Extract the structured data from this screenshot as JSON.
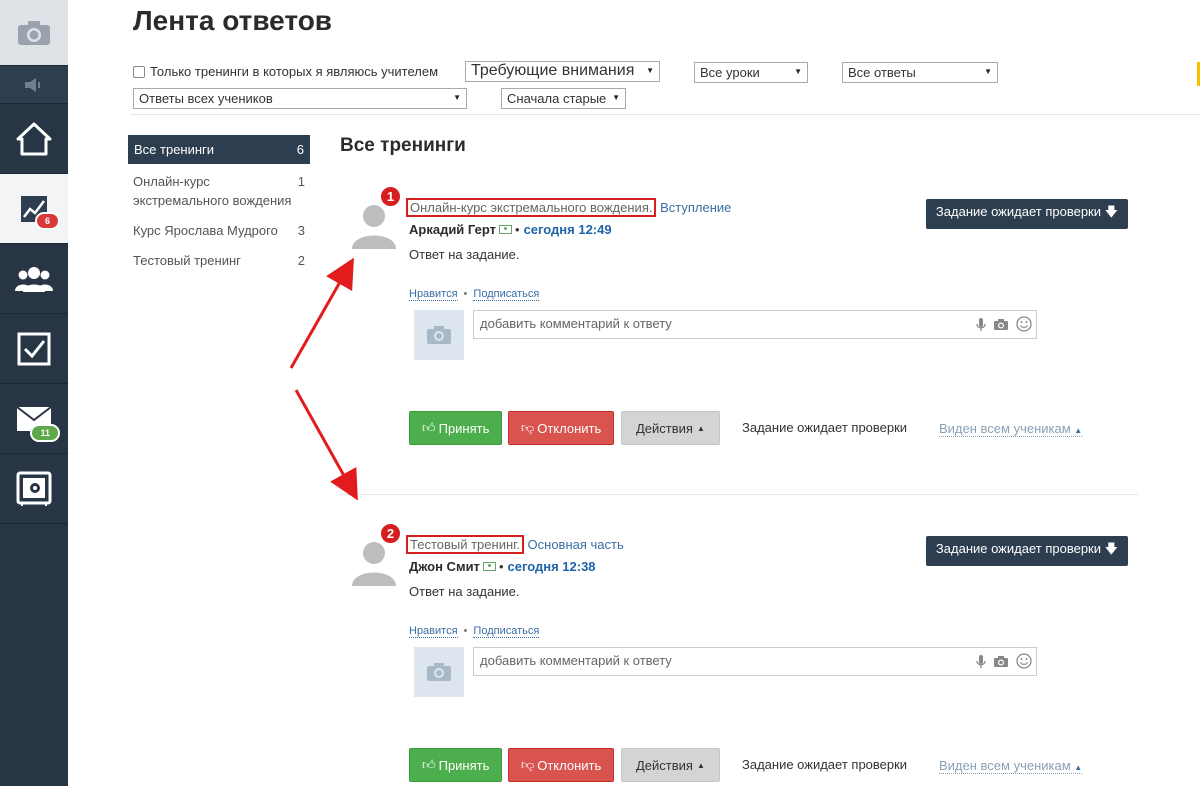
{
  "page": {
    "title": "Лента ответов",
    "section_title": "Все тренинги"
  },
  "nav": {
    "badges": {
      "trainings": "6",
      "messages": "11"
    }
  },
  "filters": {
    "only_teacher_label": "Только тренинги в которых я являюсь учителем",
    "attention": "Требующие внимания",
    "lessons": "Все уроки",
    "answers": "Все ответы",
    "students": "Ответы всех учеников",
    "order": "Сначала старые"
  },
  "trainings": [
    {
      "name": "Все тренинги",
      "count": "6"
    },
    {
      "name": "Онлайн-курс экстремального вождения",
      "count": "1"
    },
    {
      "name": "Курс Ярослава Мудрого",
      "count": "3"
    },
    {
      "name": "Тестовый тренинг",
      "count": "2"
    }
  ],
  "answers": [
    {
      "marker": "1",
      "training": "Онлайн-курс экстремального вождения.",
      "lesson": "Вступление",
      "author": "Аркадий Герт",
      "time": "сегодня 12:49",
      "text": "Ответ на задание.",
      "status_button": "Задание ожидает проверки",
      "like": "Нравится",
      "subscribe": "Подписаться",
      "comment_placeholder": "добавить комментарий к ответу",
      "accept": "Принять",
      "reject": "Отклонить",
      "actions": "Действия",
      "status_text": "Задание ожидает проверки",
      "visibility": "Виден всем ученикам"
    },
    {
      "marker": "2",
      "training": "Тестовый тренинг.",
      "lesson": "Основная часть",
      "author": "Джон Смит",
      "time": "сегодня 12:38",
      "text": "Ответ на задание.",
      "status_button": "Задание ожидает проверки",
      "like": "Нравится",
      "subscribe": "Подписаться",
      "comment_placeholder": "добавить комментарий к ответу",
      "accept": "Принять",
      "reject": "Отклонить",
      "actions": "Действия",
      "status_text": "Задание ожидает проверки",
      "visibility": "Виден всем ученикам"
    }
  ],
  "colors": {
    "nav_bg": "#273544",
    "accent_dark": "#2d3e50",
    "link": "#3a6ea5",
    "highlight_red": "#d61e1e",
    "accept_green": "#4cae4c",
    "reject_red": "#d9534f"
  }
}
